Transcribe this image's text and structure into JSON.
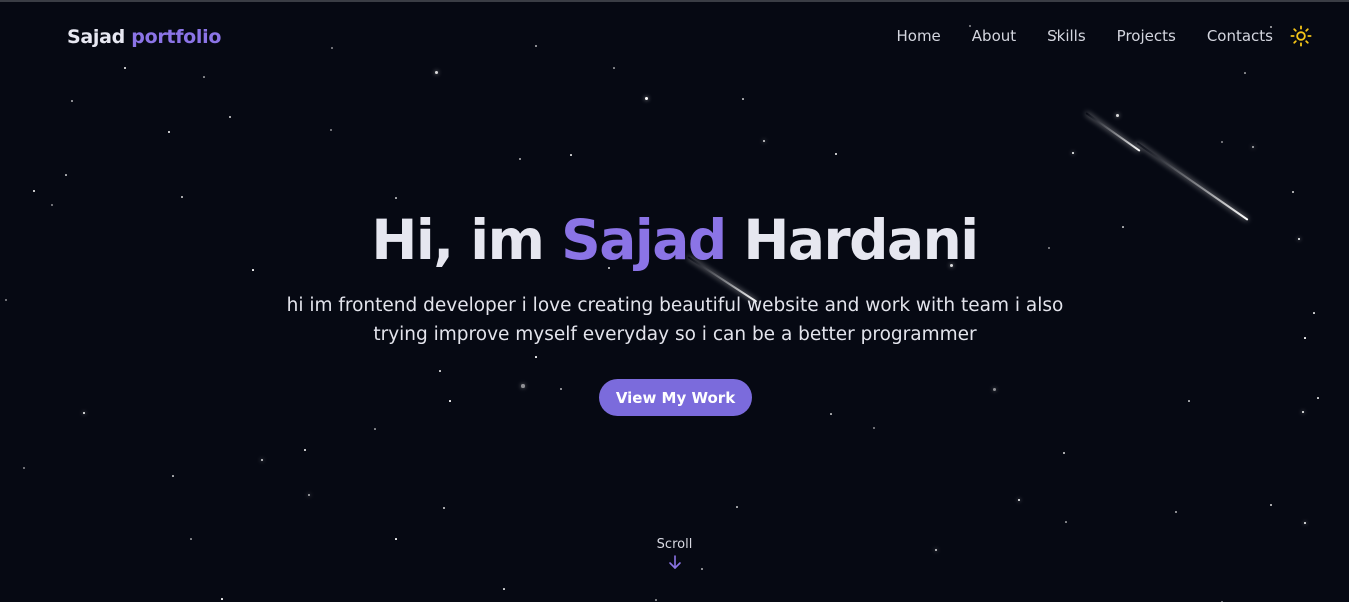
{
  "brand": {
    "name": "Sajad",
    "accent": "portfolio"
  },
  "nav": {
    "items": [
      {
        "label": "Home"
      },
      {
        "label": "About"
      },
      {
        "label": "Skills"
      },
      {
        "label": "Projects"
      },
      {
        "label": "Contacts"
      }
    ],
    "theme_toggle_icon": "sun-icon"
  },
  "hero": {
    "greeting": "Hi, im",
    "first_name": "Sajad",
    "last_name": "Hardani",
    "description": "hi im frontend developer i love creating beautiful website and work with team i also trying improve myself everyday so i can be a better programmer",
    "cta_label": "View My Work"
  },
  "scroll": {
    "label": "Scroll",
    "icon": "arrow-down-icon"
  },
  "colors": {
    "background": "#060913",
    "accent": "#8b74e6",
    "button": "#7b6bdc",
    "sun": "#f5c518",
    "text": "#e6e7f0"
  }
}
